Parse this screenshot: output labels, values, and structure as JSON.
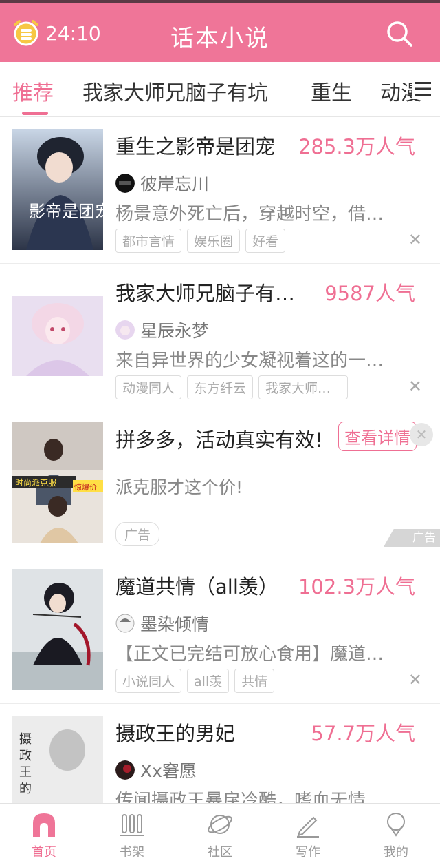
{
  "header": {
    "timer": "24:10",
    "app_title": "话本小说"
  },
  "colors": {
    "accent": "#ef7598",
    "accent_text": "#ef6f93"
  },
  "tabs": [
    {
      "label": "推荐",
      "active": true
    },
    {
      "label": "我家大师兄脑子有坑"
    },
    {
      "label": "重生"
    },
    {
      "label": "动漫"
    }
  ],
  "items": [
    {
      "title": "重生之影帝是团宠",
      "popularity": "285.3万人气",
      "author": "彼岸忘川",
      "desc": "杨景意外死亡后，穿越时空，借…",
      "tags": [
        "都市言情",
        "娱乐圈",
        "好看"
      ],
      "cover_text": "影帝是团宠"
    },
    {
      "title": "我家大师兄脑子有…",
      "popularity": "9587人气",
      "author": "星辰永梦",
      "desc": "来自异世界的少女凝视着这的一…",
      "tags": [
        "动漫同人",
        "东方纤云",
        "我家大师…"
      ]
    },
    {
      "ad": true,
      "title": "拼多多，活动真实有效!",
      "cta": "查看详情",
      "desc": "派克服才这个价!",
      "tag": "广告",
      "corner": "广告",
      "cover_text_1": "时尚派克服",
      "cover_text_2": "惊爆价"
    },
    {
      "title": "魔道共情（all羡）",
      "popularity": "102.3万人气",
      "author": "墨染倾情",
      "desc": "【正文已完结可放心食用】魔道…",
      "tags": [
        "小说同人",
        "all羡",
        "共情"
      ]
    },
    {
      "title": "摄政王的男妃",
      "popularity": "57.7万人气",
      "author": "Xx窘愿",
      "desc": "传闻摄政王暴戾冷酷，嗜血无情…",
      "tags": []
    }
  ],
  "nav": [
    {
      "label": "首页",
      "icon": "home-icon",
      "active": true
    },
    {
      "label": "书架",
      "icon": "bookshelf-icon"
    },
    {
      "label": "社区",
      "icon": "community-planet-icon"
    },
    {
      "label": "写作",
      "icon": "pen-icon"
    },
    {
      "label": "我的",
      "icon": "profile-icon"
    }
  ]
}
